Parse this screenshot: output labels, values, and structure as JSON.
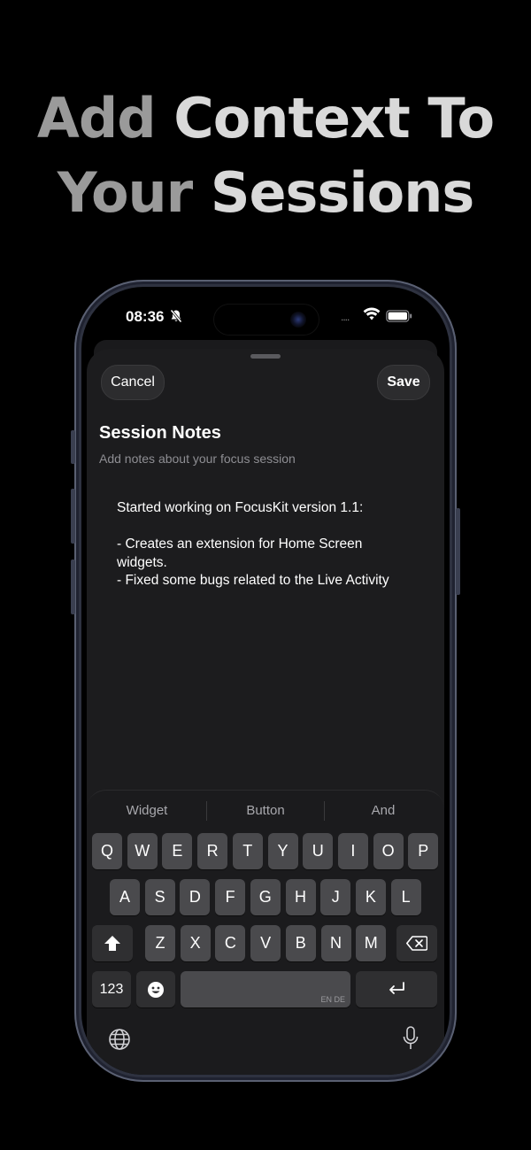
{
  "headline": {
    "line1_part1": "Add",
    "line1_part2": "Context To",
    "line2_part1": "Your",
    "line2_part2": "Sessions"
  },
  "status": {
    "time": "08:36",
    "signal": "....",
    "icons": [
      "bell-slash-icon",
      "wifi-icon",
      "battery-icon"
    ]
  },
  "sheet": {
    "cancel_label": "Cancel",
    "save_label": "Save",
    "title": "Session Notes",
    "subtitle": "Add notes about your focus session",
    "notes_lines": [
      "Started working on FocusKit version 1.1:",
      "",
      "- Creates an extension for Home Screen",
      "widgets.",
      "- Fixed some bugs related to the Live Activity"
    ]
  },
  "keyboard": {
    "suggestions": [
      "Widget",
      "Button",
      "And"
    ],
    "row1": [
      "Q",
      "W",
      "E",
      "R",
      "T",
      "Y",
      "U",
      "I",
      "O",
      "P"
    ],
    "row2": [
      "A",
      "S",
      "D",
      "F",
      "G",
      "H",
      "J",
      "K",
      "L"
    ],
    "row3": [
      "Z",
      "X",
      "C",
      "V",
      "B",
      "N",
      "M"
    ],
    "numbers_label": "123",
    "space_language": "EN DE",
    "icons": [
      "shift-icon",
      "backspace-icon",
      "emoji-icon",
      "return-icon",
      "globe-icon",
      "microphone-icon"
    ]
  },
  "colors": {
    "background": "#000000",
    "sheet": "#1c1c1e",
    "key": "#4a4a4d",
    "key_dark": "#2f2f31",
    "phone_frame": "#2e3240"
  }
}
